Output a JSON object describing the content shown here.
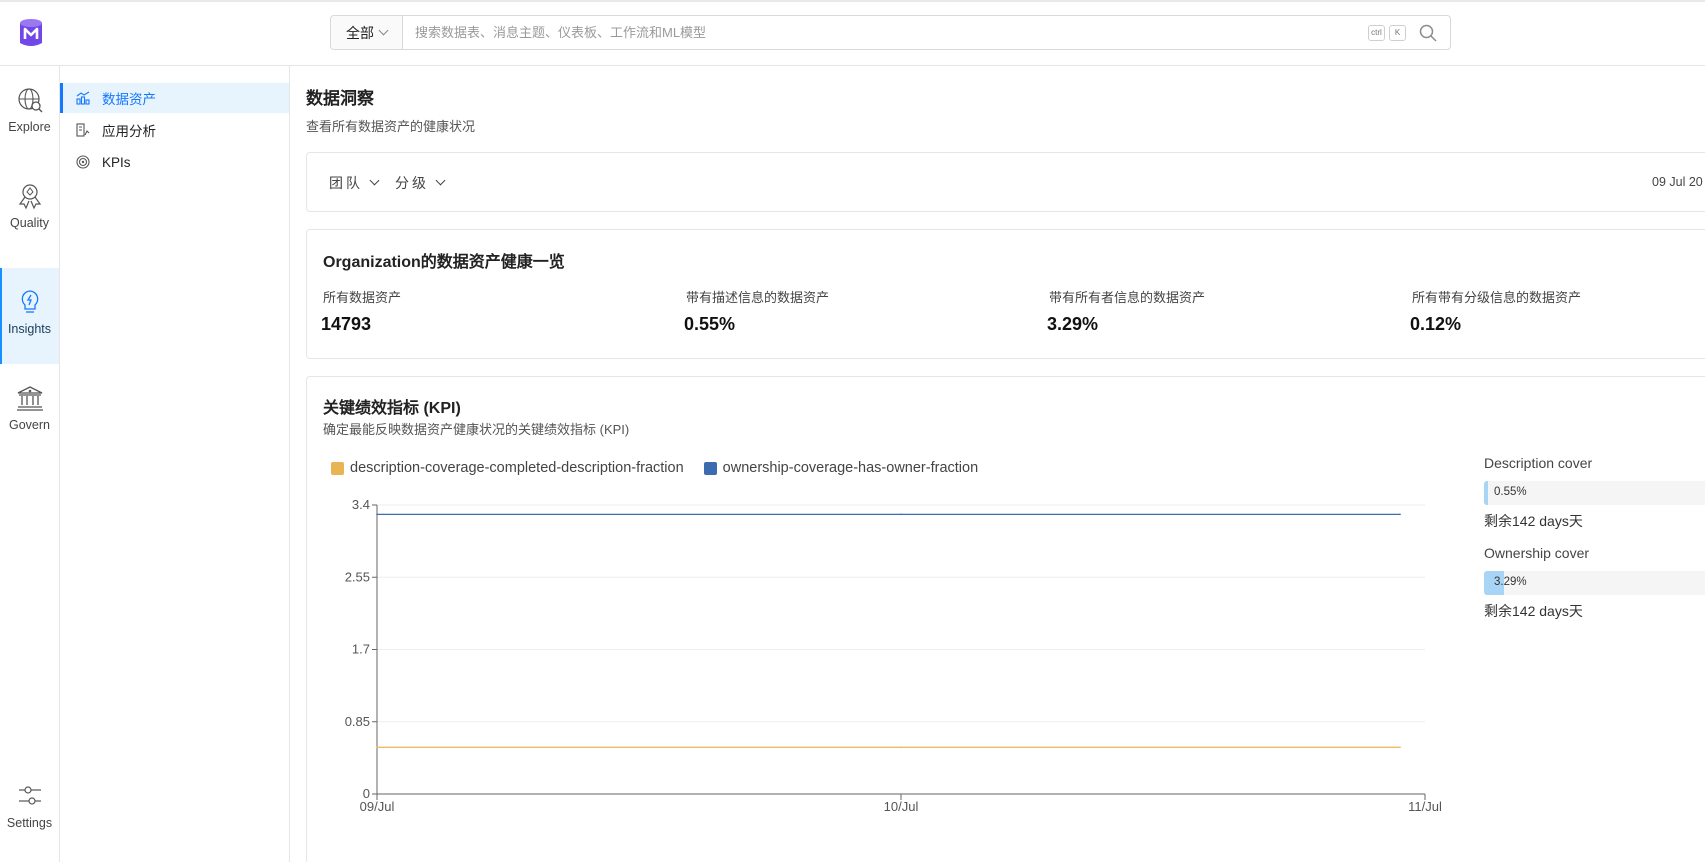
{
  "search": {
    "scope": "全部",
    "placeholder": "搜索数据表、消息主题、仪表板、工作流和ML模型",
    "shortcut_keys": [
      "ctrl",
      "K"
    ]
  },
  "rail": {
    "items": [
      {
        "label": "Explore",
        "icon": "explore-icon",
        "active": false
      },
      {
        "label": "Quality",
        "icon": "quality-icon",
        "active": false
      },
      {
        "label": "Insights",
        "icon": "insights-icon",
        "active": true
      },
      {
        "label": "Govern",
        "icon": "govern-icon",
        "active": false
      },
      {
        "label": "Settings",
        "icon": "settings-icon",
        "active": false
      }
    ]
  },
  "subnav": {
    "items": [
      {
        "label": "数据资产",
        "icon": "data-assets-icon",
        "active": true
      },
      {
        "label": "应用分析",
        "icon": "app-analytics-icon",
        "active": false
      },
      {
        "label": "KPIs",
        "icon": "kpis-icon",
        "active": false
      }
    ]
  },
  "page": {
    "title": "数据洞察",
    "subtitle": "查看所有数据资产的健康状况"
  },
  "filters": {
    "team": "团队",
    "tier": "分级",
    "date": "09 Jul 20"
  },
  "summary": {
    "title": "Organization的数据资产健康一览",
    "stats": [
      {
        "label": "所有数据资产",
        "value": "14793"
      },
      {
        "label": "带有描述信息的数据资产",
        "value": "0.55%"
      },
      {
        "label": "带有所有者信息的数据资产",
        "value": "3.29%"
      },
      {
        "label": "所有带有分级信息的数据资产",
        "value": "0.12%"
      }
    ]
  },
  "kpi": {
    "title": "关键绩效指标 (KPI)",
    "subtitle": "确定最能反映数据资产健康状况的关键绩效指标 (KPI)",
    "progress": [
      {
        "name": "Description cover",
        "value_label": "0.55%",
        "fraction": 0.0055,
        "remaining": "剩余142 days天"
      },
      {
        "name": "Ownership cover",
        "value_label": "3.29%",
        "fraction": 0.0329,
        "remaining": "剩余142 days天"
      }
    ]
  },
  "chart_data": {
    "type": "line",
    "x": [
      "09/Jul",
      "10/Jul",
      "11/Jul"
    ],
    "yticks": [
      "0",
      "0.85",
      "1.7",
      "2.55",
      "3.4"
    ],
    "ylim": [
      0,
      3.4
    ],
    "grid": true,
    "legend": "top-left",
    "series": [
      {
        "name": "description-coverage-completed-description-fraction",
        "color": "#e8b454",
        "values": [
          0.55,
          0.55,
          0.55
        ]
      },
      {
        "name": "ownership-coverage-has-owner-fraction",
        "color": "#3c6bb0",
        "values": [
          3.29,
          3.29,
          3.29
        ]
      }
    ]
  }
}
